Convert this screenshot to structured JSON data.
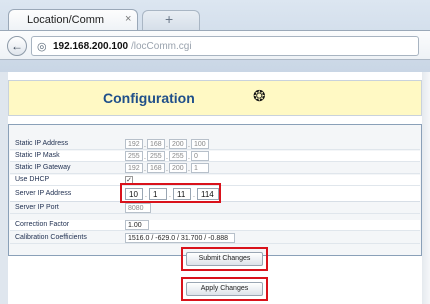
{
  "browser": {
    "tab_title": "Location/Comm",
    "tab_close": "×",
    "new_tab": "+",
    "back": "←",
    "url_host": "192.168.200.100",
    "url_path": "/locComm.cgi"
  },
  "header": {
    "title": "Configuration"
  },
  "rows": {
    "static_ip": {
      "label": "Static IP Address",
      "values": [
        "192",
        "168",
        "200",
        "100"
      ]
    },
    "static_mask": {
      "label": "Static IP Mask",
      "values": [
        "255",
        "255",
        "255",
        "0"
      ]
    },
    "static_gateway": {
      "label": "Static IP Gateway",
      "values": [
        "192",
        "168",
        "200",
        "1"
      ]
    },
    "use_dhcp": {
      "label": "Use DHCP",
      "checked": "✓"
    },
    "server_ip": {
      "label": "Server IP Address",
      "values": [
        "10",
        "1",
        "11",
        "114"
      ]
    },
    "server_port": {
      "label": "Server IP Port",
      "value": "8080"
    },
    "correction": {
      "label": "Correction Factor",
      "value": "1.00"
    },
    "calibration": {
      "label": "Calibration Coefficients",
      "value": "1516.0 / -629.0 / 31.700 / -0.888"
    }
  },
  "buttons": {
    "submit": "Submit Changes",
    "apply": "Apply Changes"
  },
  "colors": {
    "highlight": "#d9121b",
    "header_bg": "#fff9c4",
    "title": "#1f4f8a"
  }
}
